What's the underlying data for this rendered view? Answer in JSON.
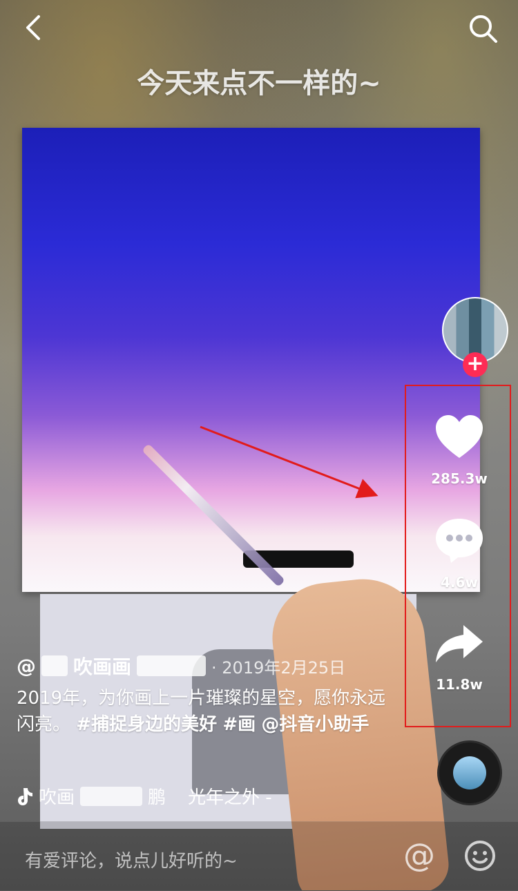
{
  "overlay_caption": "今天来点不一样的~",
  "actions": {
    "like": {
      "icon": "heart-icon",
      "count": "285.3w"
    },
    "comment": {
      "icon": "comment-bubble-icon",
      "count": "4.6w"
    },
    "share": {
      "icon": "share-arrow-icon",
      "count": "11.8w"
    }
  },
  "post": {
    "author_prefix": "@",
    "author_visible_1": "吹画画",
    "date": "· 2019年2月25日",
    "description_text": "2019年，为你画上一片璀璨的星空，愿你永远闪亮。",
    "hashtags": [
      "#捕捉身边的美好",
      "#画"
    ],
    "mention": "@抖音小助手"
  },
  "music": {
    "icon": "music-note-icon",
    "prefix_visible": "吹画",
    "suffix_visible": "鹏",
    "song": "光年之外 -"
  },
  "comment_bar": {
    "placeholder": "有爱评论，说点儿好听的~",
    "at_label": "@",
    "emoji_icon": "smiley-icon"
  },
  "colors": {
    "accent_red": "#fe2c55",
    "annotation_red": "#e21b1b"
  }
}
